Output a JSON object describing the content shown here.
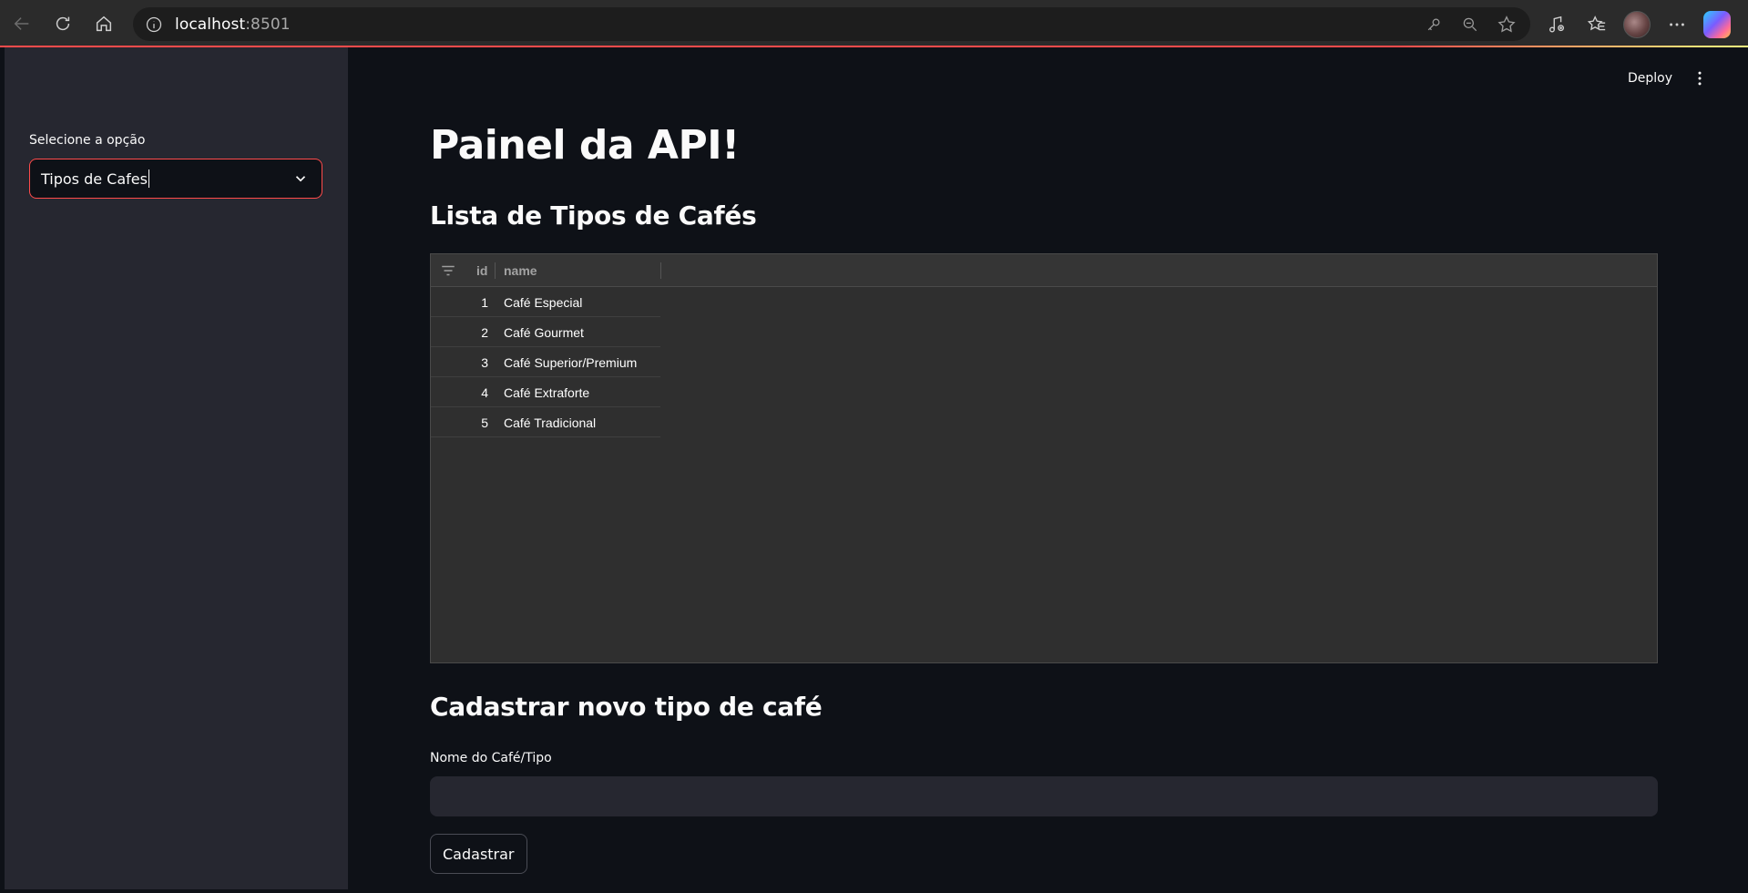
{
  "browser": {
    "url_host": "localhost",
    "url_port": ":8501"
  },
  "sidebar": {
    "select_label": "Selecione a opção",
    "select_value": "Tipos de Cafes"
  },
  "header": {
    "deploy_label": "Deploy"
  },
  "main": {
    "title": "Painel da API!",
    "list_heading": "Lista de Tipos de Cafés",
    "table": {
      "columns": [
        "id",
        "name"
      ],
      "rows": [
        {
          "id": "1",
          "name": "Café Especial"
        },
        {
          "id": "2",
          "name": "Café Gourmet"
        },
        {
          "id": "3",
          "name": "Café Superior/Premium"
        },
        {
          "id": "4",
          "name": "Café Extraforte"
        },
        {
          "id": "5",
          "name": "Café Tradicional"
        }
      ]
    },
    "form_heading": "Cadastrar novo tipo de café",
    "field_label": "Nome do Café/Tipo",
    "field_value": "",
    "submit_label": "Cadastrar"
  },
  "colors": {
    "accent": "#ff4b4b",
    "background": "#0e1117",
    "sidebar": "#262730"
  }
}
